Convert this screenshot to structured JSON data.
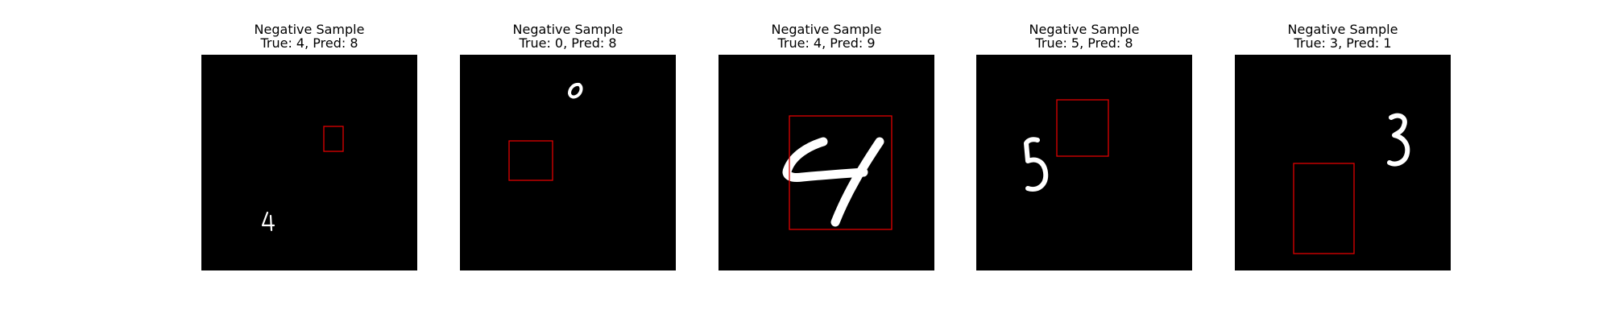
{
  "panels": [
    {
      "title": "Negative Sample",
      "subtitle": "True: 4, Pred: 8",
      "true_label": 4,
      "pred_label": 8,
      "digit_shown": "4"
    },
    {
      "title": "Negative Sample",
      "subtitle": "True: 0, Pred: 8",
      "true_label": 0,
      "pred_label": 8,
      "digit_shown": "0"
    },
    {
      "title": "Negative Sample",
      "subtitle": "True: 4, Pred: 9",
      "true_label": 4,
      "pred_label": 9,
      "digit_shown": "4"
    },
    {
      "title": "Negative Sample",
      "subtitle": "True: 5, Pred: 8",
      "true_label": 5,
      "pred_label": 8,
      "digit_shown": "5"
    },
    {
      "title": "Negative Sample",
      "subtitle": "True: 3, Pred: 1",
      "true_label": 3,
      "pred_label": 1,
      "digit_shown": "3"
    }
  ],
  "colors": {
    "image_background": "#000000",
    "digit": "#ffffff",
    "bounding_box": "#e00000",
    "page_background": "#ffffff"
  }
}
